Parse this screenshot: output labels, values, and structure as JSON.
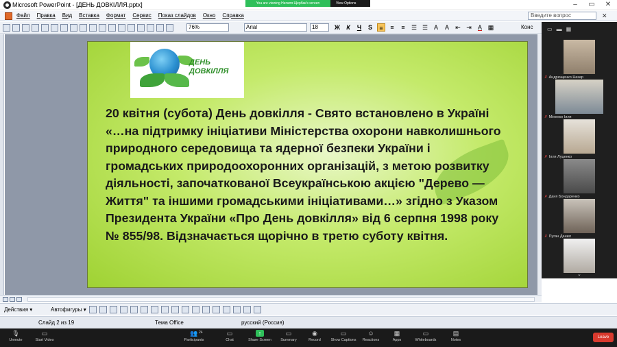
{
  "window": {
    "title": "Microsoft PowerPoint - [ДЕНЬ ДОВКІЛЛЯ.pptx]",
    "share_banner": "You are viewing Наталя Щербак's screen",
    "view_options": "View Options"
  },
  "menu": {
    "items": [
      "Файл",
      "Правка",
      "Вид",
      "Вставка",
      "Формат",
      "Сервис",
      "Показ слайдов",
      "Окно",
      "Справка"
    ],
    "ask_placeholder": "Введите вопрос"
  },
  "toolbar": {
    "zoom": "76%",
    "font": "Arial",
    "size": "18",
    "bold": "Ж",
    "italic": "К",
    "underline": "Ч",
    "shadow": "S",
    "konst": "Конс"
  },
  "slide": {
    "logo_text": "ДЕНЬ ДОВКІЛЛЯ",
    "body": "20 квітня (субота) День довкілля - Свято встановлено в Україні «…на підтримку ініціативи Міністерства охорони навколишнього природного середовища та ядерної безпеки України і громадських природоохоронних організацій, з метою розвитку діяльності, започаткованої Всеукраїнською акцією \"Дерево — Життя\" та іншими громадськими ініціативами…» згідно з Указом Президента України «Про День довкілля» від 6 серпня 1998 року № 855/98. Відзначається щорічно в третю суботу квітня."
  },
  "gallery": {
    "participants": [
      {
        "name": "Андрющенко Назар"
      },
      {
        "name": "Міненко Ілля"
      },
      {
        "name": "Ілля Луценко"
      },
      {
        "name": "Даня Бондаренко"
      },
      {
        "name": "Пуган Данил"
      },
      {
        "name": ""
      }
    ]
  },
  "drawbar": {
    "actions": "Действия ▾",
    "autoshapes": "Автофигуры ▾"
  },
  "status": {
    "slide": "Слайд 2 из 19",
    "theme": "Тема Office",
    "language": "русский (Россия)"
  },
  "meeting": {
    "buttons": [
      "Unmute",
      "Start Video",
      "Participants",
      "Chat",
      "Share Screen",
      "Summary",
      "Record",
      "Show Captions",
      "Reactions",
      "Apps",
      "Whiteboards",
      "Notes"
    ],
    "participants_count": "24",
    "leave": "Leave"
  }
}
